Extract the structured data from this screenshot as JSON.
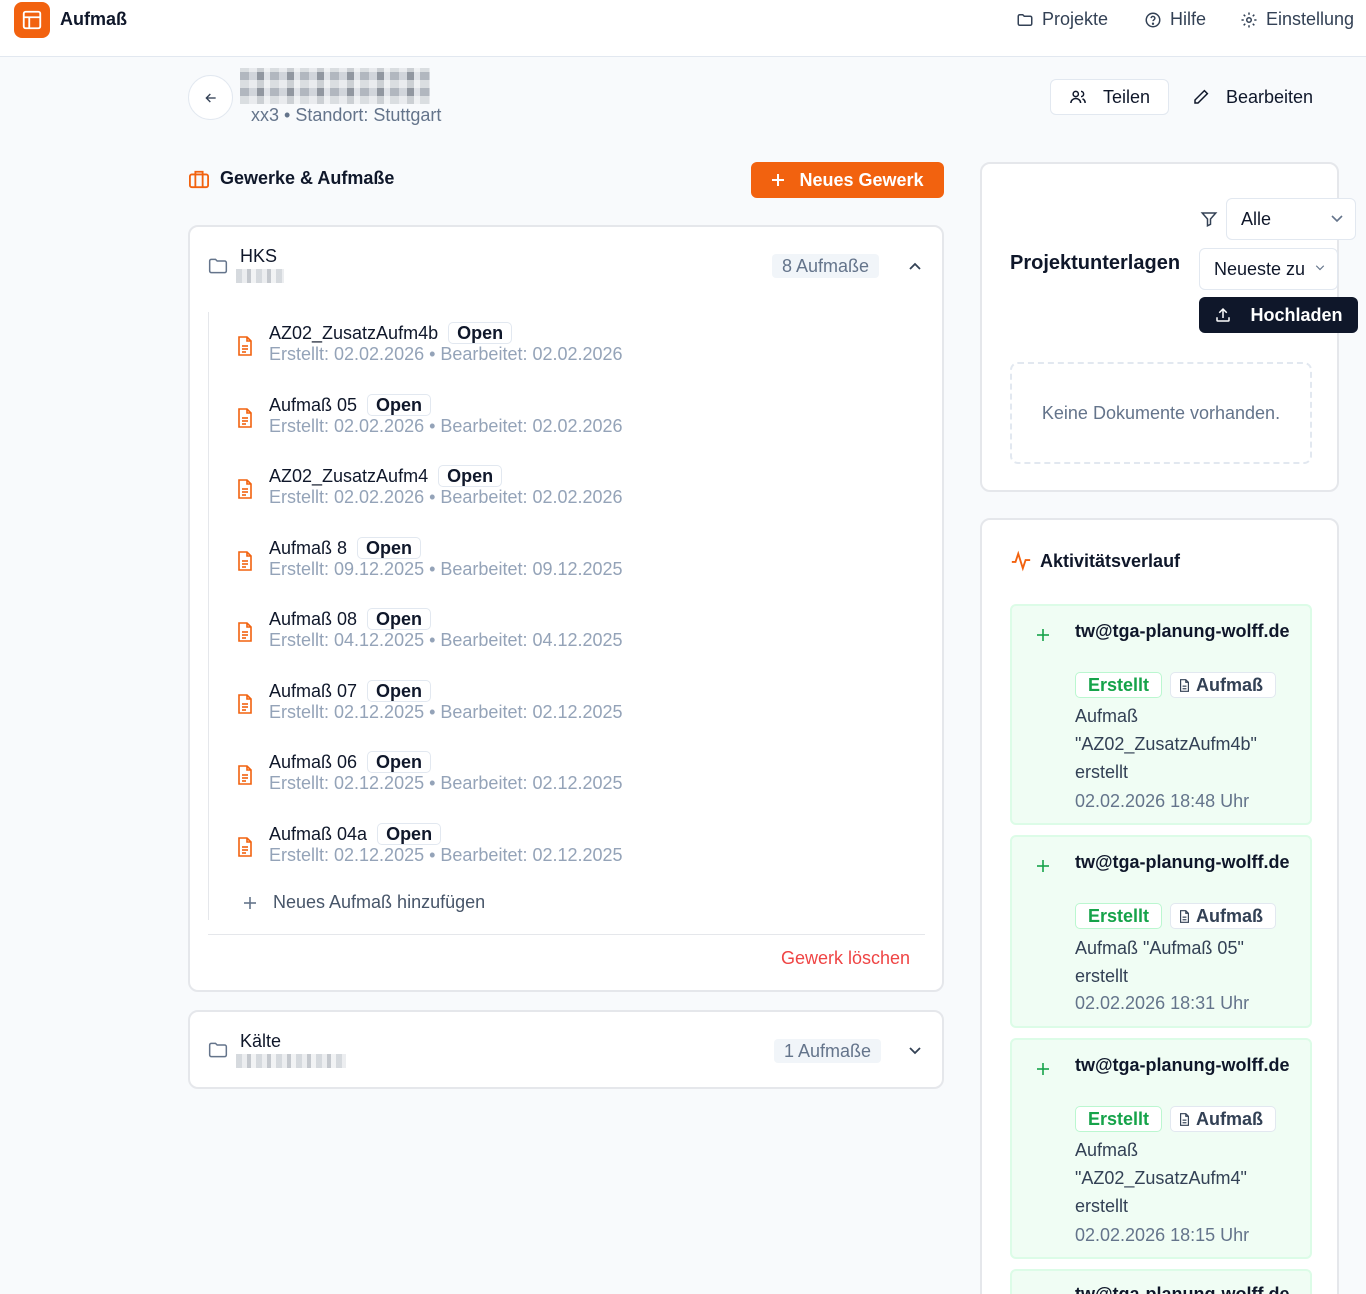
{
  "app": {
    "title": "Aufmaß"
  },
  "nav": {
    "projects": "Projekte",
    "help": "Hilfe",
    "settings": "Einstellung"
  },
  "project": {
    "meta": "xx3  •  Standort: Stuttgart"
  },
  "actions": {
    "share": "Teilen",
    "edit": "Bearbeiten"
  },
  "section": {
    "title": "Gewerke & Aufmaße",
    "new_gewerk": "Neues Gewerk"
  },
  "gewerke": [
    {
      "name": "HKS",
      "count": "8 Aufmaße",
      "expanded": true,
      "items": [
        {
          "title": "AZ02_ZusatzAufm4b",
          "status": "Open",
          "meta": "Erstellt: 02.02.2026  •  Bearbeitet: 02.02.2026"
        },
        {
          "title": "Aufmaß 05",
          "status": "Open",
          "meta": "Erstellt: 02.02.2026  •  Bearbeitet: 02.02.2026"
        },
        {
          "title": "AZ02_ZusatzAufm4",
          "status": "Open",
          "meta": "Erstellt: 02.02.2026  •  Bearbeitet: 02.02.2026"
        },
        {
          "title": "Aufmaß 8",
          "status": "Open",
          "meta": "Erstellt: 09.12.2025  •  Bearbeitet: 09.12.2025"
        },
        {
          "title": "Aufmaß 08",
          "status": "Open",
          "meta": "Erstellt: 04.12.2025  •  Bearbeitet: 04.12.2025"
        },
        {
          "title": "Aufmaß 07",
          "status": "Open",
          "meta": "Erstellt: 02.12.2025  •  Bearbeitet: 02.12.2025"
        },
        {
          "title": "Aufmaß 06",
          "status": "Open",
          "meta": "Erstellt: 02.12.2025  •  Bearbeitet: 02.12.2025"
        },
        {
          "title": "Aufmaß 04a",
          "status": "Open",
          "meta": "Erstellt: 02.12.2025  •  Bearbeitet: 02.12.2025"
        }
      ],
      "add_label": "Neues Aufmaß hinzufügen",
      "delete_label": "Gewerk löschen"
    },
    {
      "name": "Kälte",
      "count": "1 Aufmaße",
      "expanded": false
    }
  ],
  "documents": {
    "title": "Projektunterlagen",
    "filter_value": "Alle",
    "sort_value": "Neueste zu",
    "upload": "Hochladen",
    "empty": "Keine Dokumente vorhanden."
  },
  "activity": {
    "title": "Aktivitätsverlauf",
    "items": [
      {
        "user": "tw@tga-planung-wolff.de",
        "action": "Erstellt",
        "type": "Aufmaß",
        "desc": "Aufmaß \"AZ02_ZusatzAufm4b\" erstellt",
        "time": "02.02.2026 18:48 Uhr"
      },
      {
        "user": "tw@tga-planung-wolff.de",
        "action": "Erstellt",
        "type": "Aufmaß",
        "desc": "Aufmaß \"Aufmaß 05\" erstellt",
        "time": "02.02.2026 18:31 Uhr"
      },
      {
        "user": "tw@tga-planung-wolff.de",
        "action": "Erstellt",
        "type": "Aufmaß",
        "desc": "Aufmaß \"AZ02_ZusatzAufm4\" erstellt",
        "time": "02.02.2026 18:15 Uhr"
      },
      {
        "user": "tw@tga-planung-wolff.de"
      }
    ]
  },
  "colors": {
    "accent": "#f2620f",
    "dark": "#0f172a",
    "success": "#16a34a",
    "danger": "#ef4444"
  }
}
